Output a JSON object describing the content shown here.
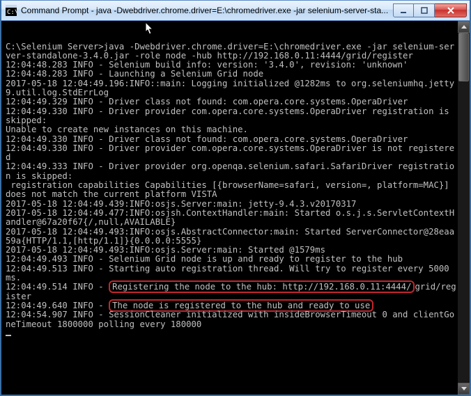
{
  "window": {
    "title": "Command Prompt - java  -Dwebdriver.chrome.driver=E:\\chromedriver.exe -jar selenium-server-sta..."
  },
  "cmd": {
    "prompt": "C:\\Selenium Server>",
    "command": "java -Dwebdriver.chrome.driver=E:\\chromedriver.exe -jar selenium-server-standalone-3.4.0.jar -role node -hub http://192.168.0.11:4444/grid/register"
  },
  "lines": {
    "l1": "12:04:48.283 INFO - Selenium build info: version: '3.4.0', revision: 'unknown'",
    "l2": "12:04:48.283 INFO - Launching a Selenium Grid node",
    "l3": "2017-05-18 12:04:49.196:INFO::main: Logging initialized @1282ms to org.seleniumhq.jetty9.util.log.StdErrLog",
    "l4": "12:04:49.329 INFO - Driver class not found: com.opera.core.systems.OperaDriver",
    "l5": "12:04:49.330 INFO - Driver provider com.opera.core.systems.OperaDriver registration is skipped:",
    "l6": "Unable to create new instances on this machine.",
    "l7": "12:04:49.330 INFO - Driver class not found: com.opera.core.systems.OperaDriver",
    "l8": "12:04:49.330 INFO - Driver provider com.opera.core.systems.OperaDriver is not registered",
    "l9": "12:04:49.333 INFO - Driver provider org.openqa.selenium.safari.SafariDriver registration is skipped:",
    "l10": " registration capabilities Capabilities [{browserName=safari, version=, platform=MAC}] does not match the current platform VISTA",
    "l11": "2017-05-18 12:04:49.439:INFO:osjs.Server:main: jetty-9.4.3.v20170317",
    "l12": "2017-05-18 12:04:49.477:INFO:osjsh.ContextHandler:main: Started o.s.j.s.ServletContextHandler@67a20f67{/,null,AVAILABLE}",
    "l13": "2017-05-18 12:04:49.493:INFO:osjs.AbstractConnector:main: Started ServerConnector@28eaa59a{HTTP/1.1,[http/1.1]}{0.0.0.0:5555}",
    "l14": "2017-05-18 12:04:49.493:INFO:osjs.Server:main: Started @1579ms",
    "l15": "12:04:49.493 INFO - Selenium Grid node is up and ready to register to the hub",
    "l16": "12:04:49.513 INFO - Starting auto registration thread. Will try to register every 5000 ms.",
    "l17a": "12:04:49.514 INFO - ",
    "l17b": "Registering the node to the hub: http://192.168.0.11:4444/",
    "l17c": "grid/register",
    "l18a": "12:04:49.640 INFO - ",
    "l18b": "The node is registered to the hub and ready to use",
    "l19": "12:04:54.907 INFO - SessionCleaner initialized with insideBrowserTimeout 0 and clientGoneTimeout 1800000 polling every 180000"
  }
}
